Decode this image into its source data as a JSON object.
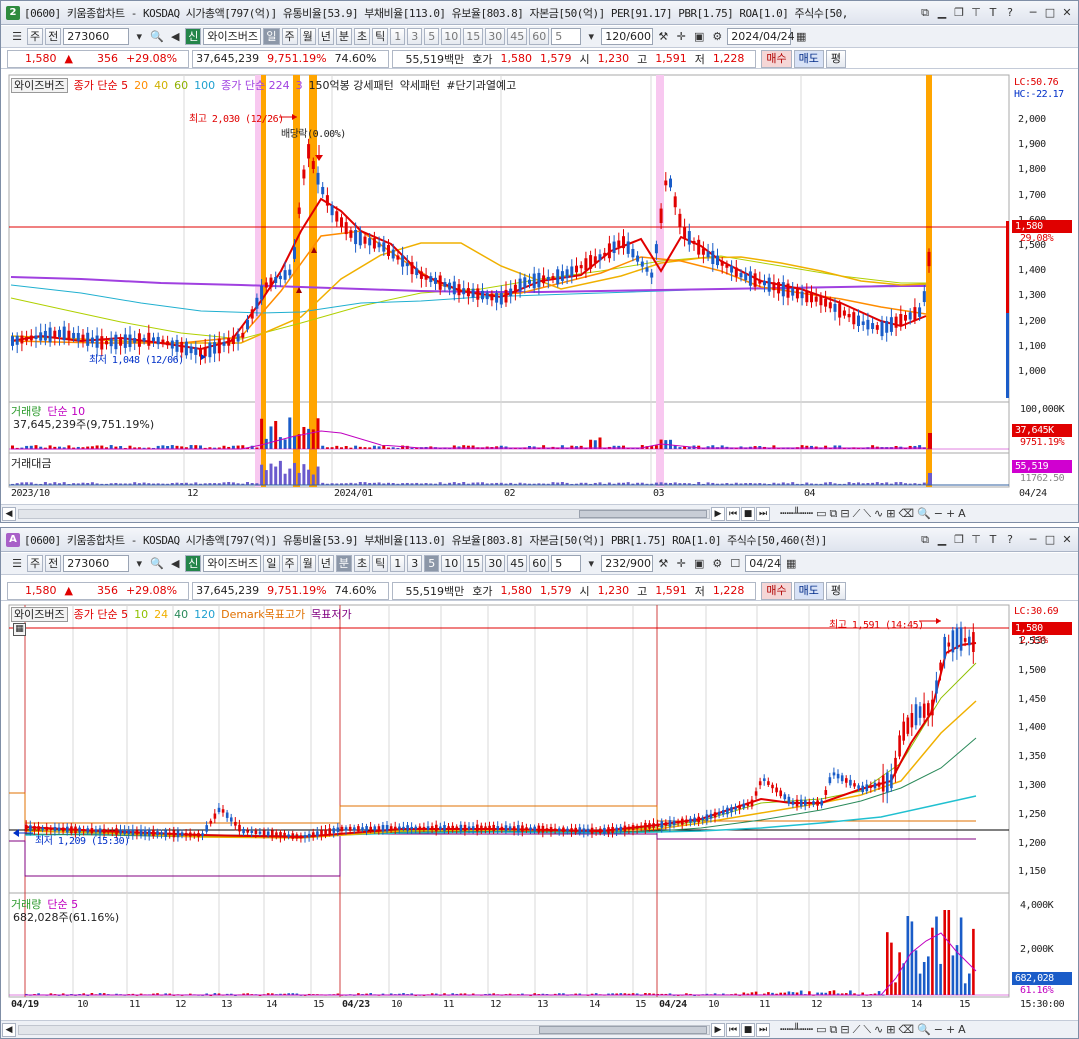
{
  "top": {
    "badge": "2",
    "title": "[0600] 키움종합차트 - KOSDAQ 시가총액[797(억)] 유통비율[53.9] 부채비율[113.0] 유보율[803.8] 자본금[50(억)] PER[91.17] PBR[1.75] ROA[1.0] 주식수[50,",
    "toolbar": {
      "type": "주",
      "kind": "전",
      "code": "273060",
      "badge": "신",
      "name": "와이즈버즈",
      "periods": [
        "일",
        "주",
        "월",
        "년",
        "분",
        "초",
        "틱"
      ],
      "active_period": "일",
      "intervals": [
        "1",
        "3",
        "5",
        "10",
        "15",
        "30",
        "45",
        "60"
      ],
      "interval_value": "5",
      "count": "120/600",
      "date": "2024/04/24"
    },
    "quote": {
      "price": "1,580",
      "arrow": "▲",
      "change": "356",
      "change_pct": "+29.08%",
      "volume": "37,645,239",
      "volume_pct": "9,751.19%",
      "ratio": "74.60%",
      "amount": "55,519백만",
      "ask_label": "호가",
      "ask1": "1,580",
      "ask2": "1,579",
      "open_label": "시",
      "open": "1,230",
      "high_label": "고",
      "high": "1,591",
      "low_label": "저",
      "low": "1,228",
      "buy": "매수",
      "sell": "매도",
      "eval": "평"
    },
    "legend": [
      "와이즈버즈",
      "종가 단순 5",
      "20",
      "40",
      "60",
      "100",
      "종가 단순 224",
      "3",
      "150억봉 강세패턴",
      "약세패턴",
      "#단기과열예고"
    ],
    "lc": "LC:50.76",
    "hc": "HC:-22.17",
    "price_ticks": [
      "2,000",
      "1,900",
      "1,800",
      "1,700",
      "1,600",
      "1,500",
      "1,400",
      "1,300",
      "1,200",
      "1,100",
      "1,000"
    ],
    "cur_box": "1,580",
    "cur_pct": "29.08%",
    "high_note": "최고 2,030 (12/26)",
    "low_note": "최저 1,048 (12/06)",
    "div_note": "배당락(0.00%)",
    "vol_label": "거래량",
    "vol_ma": "단순 10",
    "vol_text": "37,645,239주(9,751.19%)",
    "vol_tick": "100,000K",
    "vol_box": "37,645K",
    "vol_pct": "9751.19%",
    "amt_label": "거래대금",
    "amt_box": "55,519",
    "amt_pct": "11762.50",
    "dates": [
      "2023/10",
      "12",
      "2024/01",
      "02",
      "03",
      "04"
    ],
    "end_date": "04/24"
  },
  "bottom": {
    "badge": "A",
    "title": "[0600] 키움종합차트 - KOSDAQ 시가총액[797(억)] 유통비율[53.9] 부채비율[113.0] 유보율[803.8] 자본금[50(억)] PBR[1.75] ROA[1.0] 주식수[50,460(천)]",
    "toolbar": {
      "type": "주",
      "kind": "전",
      "code": "273060",
      "badge": "신",
      "name": "와이즈버즈",
      "periods": [
        "일",
        "주",
        "월",
        "년",
        "분",
        "초",
        "틱"
      ],
      "active_period": "분",
      "intervals": [
        "1",
        "3",
        "5",
        "10",
        "15",
        "30",
        "45",
        "60"
      ],
      "active_interval": "5",
      "interval_value": "5",
      "count": "232/900",
      "date": "04/24"
    },
    "quote": {
      "price": "1,580",
      "arrow": "▲",
      "change": "356",
      "change_pct": "+29.08%",
      "volume": "37,645,239",
      "volume_pct": "9,751.19%",
      "ratio": "74.60%",
      "amount": "55,519백만",
      "ask_label": "호가",
      "ask1": "1,580",
      "ask2": "1,579",
      "open_label": "시",
      "open": "1,230",
      "high_label": "고",
      "high": "1,591",
      "low_label": "저",
      "low": "1,228",
      "buy": "매수",
      "sell": "매도",
      "eval": "평"
    },
    "legend": [
      "와이즈버즈",
      "종가 단순 5",
      "10",
      "24",
      "40",
      "120",
      "Demark목표고가",
      "목표저가"
    ],
    "lc": "LC:30.69",
    "price_ticks": [
      "1,550",
      "1,500",
      "1,450",
      "1,400",
      "1,350",
      "1,300",
      "1,250",
      "1,200",
      "1,150"
    ],
    "cur_box": "1,580",
    "cur_pct": "2.13%",
    "high_note": "최고 1,591 (14:45)",
    "low_note": "최저 1,209 (15:30)",
    "vol_label": "거래량",
    "vol_ma": "단순 5",
    "vol_text": "682,028주(61.16%)",
    "vol_ticks": [
      "4,000K",
      "2,000K"
    ],
    "vol_box": "682,028",
    "vol_pct": "61.16%",
    "dates": [
      "04/19",
      "10",
      "11",
      "12",
      "13",
      "14",
      "15",
      "04/23",
      "10",
      "11",
      "12",
      "13",
      "14",
      "15",
      "04/24",
      "10",
      "11",
      "12",
      "13",
      "14",
      "15"
    ],
    "end_time": "15:30:00"
  }
}
